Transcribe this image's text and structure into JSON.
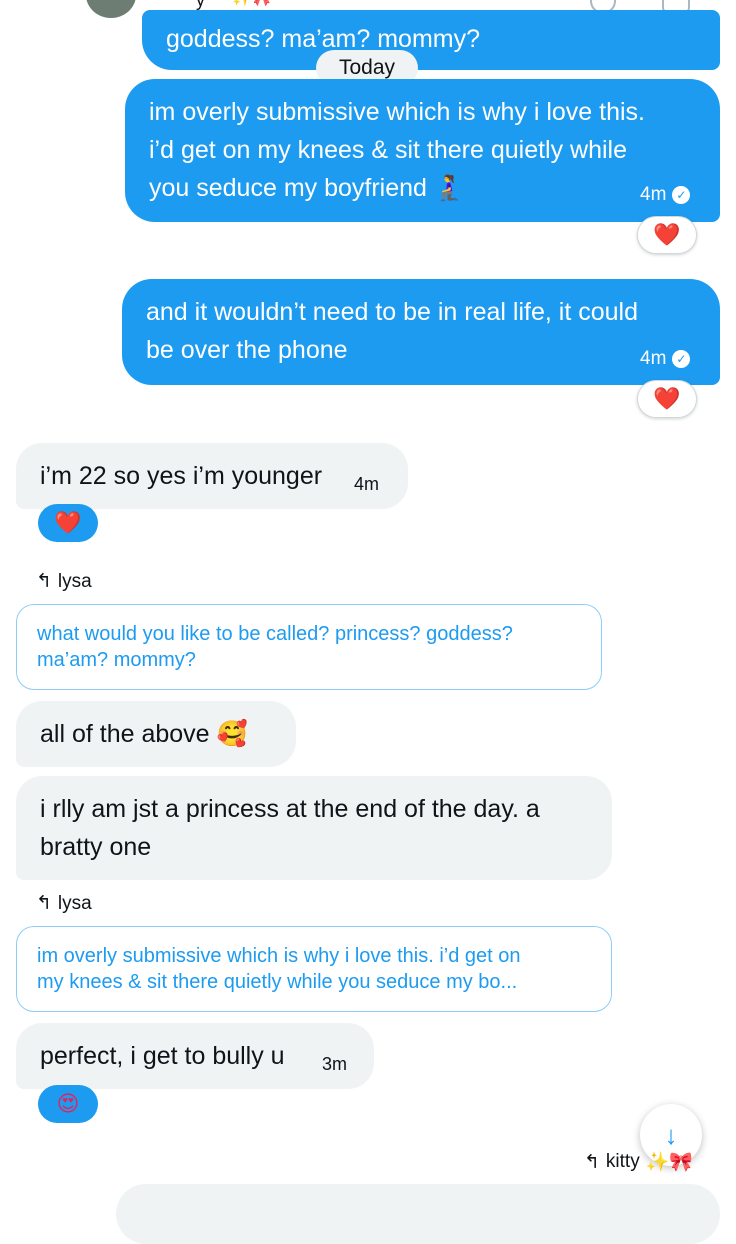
{
  "header": {
    "name": "y",
    "badge": "✨🎀",
    "avatar_icon": "avatar-image"
  },
  "colors": {
    "accent": "#1d9bf0",
    "incoming_bubble": "#eff3f4",
    "heart": "#e0245e"
  },
  "date_divider": "Today",
  "messages": [
    {
      "id": "m0",
      "direction": "out",
      "text": "goddess? ma’am? mommy?"
    },
    {
      "id": "m1",
      "direction": "out",
      "lines": [
        "im overly submissive which is why i love this.",
        "i’d get on my knees & sit there quietly while",
        "you seduce my boyfriend 🧎‍♀️"
      ],
      "time": "4m",
      "reaction": "❤️"
    },
    {
      "id": "m2",
      "direction": "out",
      "lines": [
        "and it wouldn’t need to be in real life, it could",
        "be over the phone"
      ],
      "time": "4m",
      "reaction": "❤️"
    },
    {
      "id": "m3",
      "direction": "in",
      "text": "i’m 22 so yes i’m younger",
      "time": "4m",
      "reaction": "❤️"
    },
    {
      "id": "m4",
      "direction": "in",
      "reply_to": "lysa",
      "quote_lines": [
        "what would you like to be called? princess? goddess?",
        "ma’am? mommy?"
      ],
      "text": "all of the above 🥰"
    },
    {
      "id": "m5",
      "direction": "in",
      "lines": [
        "i rlly am jst a princess at the end of the day. a",
        "bratty one"
      ]
    },
    {
      "id": "m6",
      "direction": "in",
      "reply_to": "lysa",
      "quote_lines": [
        "im overly submissive which is why i love this. i’d get on",
        "my knees & sit there quietly while you seduce my bo..."
      ],
      "text": "perfect, i get to bully u",
      "time": "3m",
      "reaction": "😍"
    },
    {
      "id": "m7",
      "direction": "out",
      "reply_to": "kitty",
      "reply_badge": "✨🎀"
    }
  ],
  "icons": {
    "reply": "↰",
    "check": "✓",
    "scroll_down": "↓"
  }
}
